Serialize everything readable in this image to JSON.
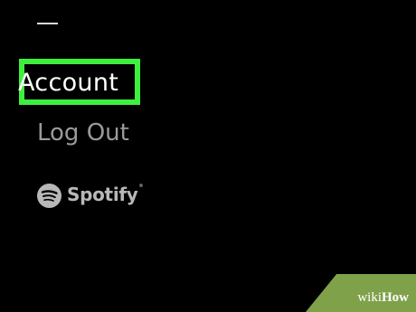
{
  "menu": {
    "account_label": "Account",
    "logout_label": "Log Out"
  },
  "logo": {
    "wordmark": "Spotify",
    "trademark": "®"
  },
  "watermark": {
    "wiki": "wiki",
    "how": "How"
  },
  "colors": {
    "background": "#000000",
    "highlight_box": "#3ef03e",
    "primary_text": "#ffffff",
    "secondary_text": "#9a9a9a",
    "watermark_bg": "#7fa14a"
  },
  "icons": {
    "menu_dash": "minus-icon",
    "spotify_logo": "spotify-icon"
  }
}
